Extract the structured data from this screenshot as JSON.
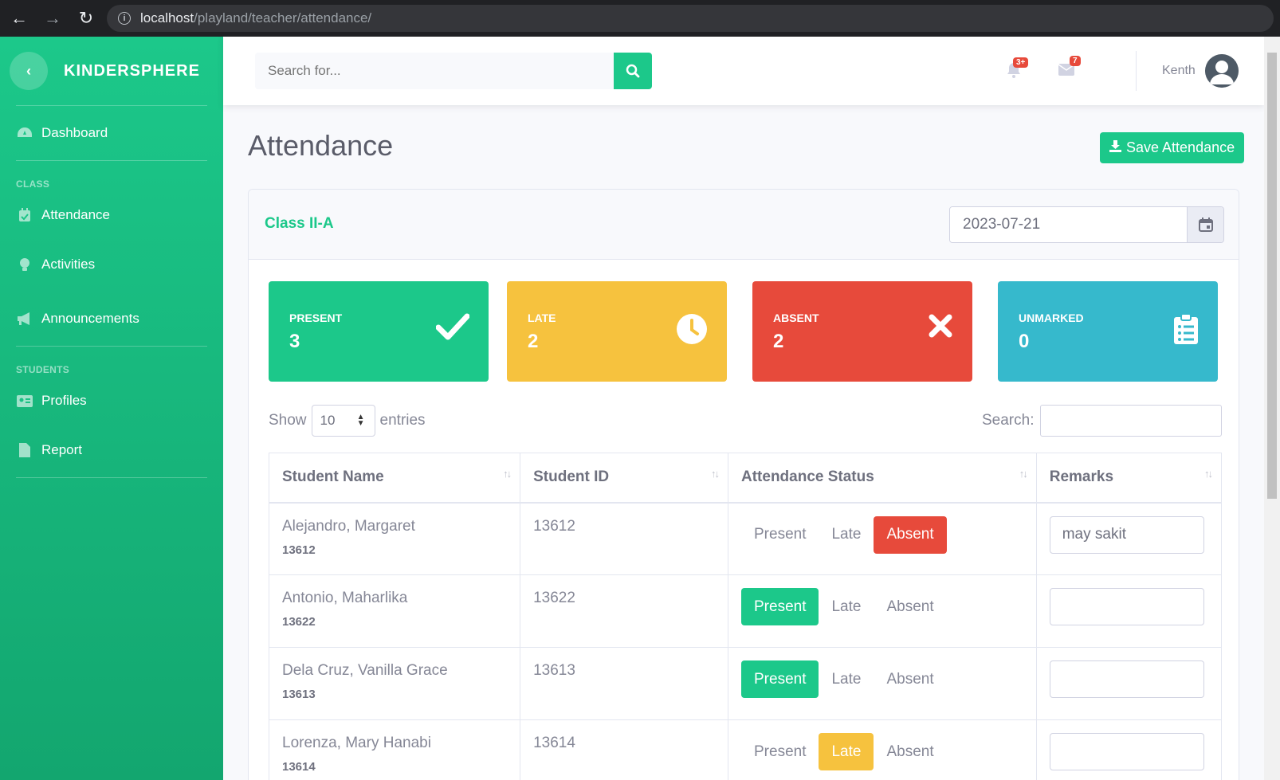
{
  "browser": {
    "url_host": "localhost",
    "url_path": "/playland/teacher/attendance/"
  },
  "sidebar": {
    "brand": "KINDERSPHERE",
    "items": [
      {
        "label": "Dashboard",
        "icon": "dashboard-icon"
      },
      {
        "heading": "CLASS"
      },
      {
        "label": "Attendance",
        "icon": "calendar-check-icon"
      },
      {
        "label": "Activities",
        "icon": "lightbulb-icon"
      },
      {
        "label": "Announcements",
        "icon": "bullhorn-icon"
      },
      {
        "heading": "STUDENTS"
      },
      {
        "label": "Profiles",
        "icon": "id-card-icon"
      },
      {
        "label": "Report",
        "icon": "file-icon"
      }
    ]
  },
  "topbar": {
    "search_placeholder": "Search for...",
    "alerts_badge": "3+",
    "messages_badge": "7",
    "user_name": "Kenth"
  },
  "page": {
    "title": "Attendance",
    "save_label": "Save Attendance"
  },
  "card": {
    "class_name": "Class II-A",
    "date": "2023-07-21"
  },
  "stats": {
    "present": {
      "label": "PRESENT",
      "value": "3",
      "color": "#1cc88a"
    },
    "late": {
      "label": "LATE",
      "value": "2",
      "color": "#f6c23e"
    },
    "absent": {
      "label": "ABSENT",
      "value": "2",
      "color": "#e74a3b"
    },
    "unmarked": {
      "label": "UNMARKED",
      "value": "0",
      "color": "#36b9cc"
    }
  },
  "table_controls": {
    "show": "Show",
    "entries_value": "10",
    "entries": "entries",
    "search_label": "Search:"
  },
  "table": {
    "headers": [
      "Student Name",
      "Student ID",
      "Attendance Status",
      "Remarks"
    ],
    "status_options": [
      "Present",
      "Late",
      "Absent"
    ],
    "rows": [
      {
        "name": "Alejandro, Margaret",
        "sub_id": "13612",
        "id": "13612",
        "status": "Absent",
        "remarks": "may sakit"
      },
      {
        "name": "Antonio, Maharlika",
        "sub_id": "13622",
        "id": "13622",
        "status": "Present",
        "remarks": ""
      },
      {
        "name": "Dela Cruz, Vanilla Grace",
        "sub_id": "13613",
        "id": "13613",
        "status": "Present",
        "remarks": ""
      },
      {
        "name": "Lorenza, Mary Hanabi",
        "sub_id": "13614",
        "id": "13614",
        "status": "Late",
        "remarks": ""
      }
    ]
  }
}
